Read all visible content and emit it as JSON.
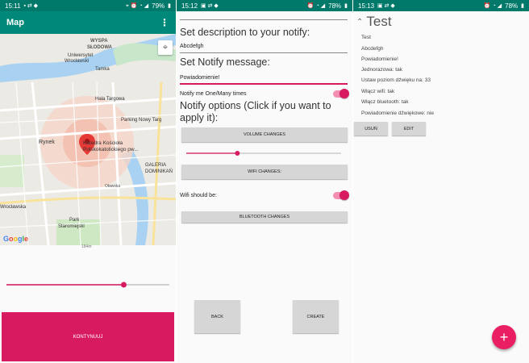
{
  "screen1": {
    "status": {
      "time": "15:11",
      "battery": "79%"
    },
    "appbar": {
      "title": "Map",
      "more_icon": "more-vert-icon"
    },
    "map": {
      "labels": {
        "wyspa": "WYSPA",
        "slodowa": "SŁODOWA",
        "uniwersytet": "Uniwersytet",
        "wroclawski": "Wrocławski",
        "tamka": "Tamka",
        "hala": "Hala Targowa",
        "parking": "Parking Nowy Targ",
        "rynek": "Rynek",
        "katedra1": "Katedra Kościoła",
        "katedra2": "Polskokatolickiego pw...",
        "galeria1": "GALERIA",
        "galeria2": "DOMINIKAŃ",
        "wroclawska": "Wrocławska",
        "park1": "Park",
        "park2": "Staromiejski",
        "olawska": "Oławska"
      },
      "google": "Google",
      "scale": "184m"
    },
    "slider": {
      "value_fraction": 0.72
    },
    "button": {
      "label": "KONTYNUUJ"
    }
  },
  "screen2": {
    "status": {
      "time": "15:12",
      "battery": "78%"
    },
    "description_label": "Set description to your notify:",
    "description_value": "Abcdefgh",
    "message_label": "Set Notify message:",
    "message_value": "Powiadomienie!",
    "notify_label": "Notify me One/Many times",
    "options_label_1": "Notify options (Click if you want to",
    "options_label_2": "apply it):",
    "volume_button": "VOLUME CHANGES",
    "volume_slider_fraction": 0.33,
    "wifi_button": "WIFI CHANGES:",
    "wifi_label": "Wifi should be:",
    "bluetooth_button": "BLUETOOTH CHANGES",
    "back_button": "BACK",
    "create_button": "CREATE"
  },
  "screen3": {
    "status": {
      "time": "15:13",
      "battery": "78%"
    },
    "title": "Test",
    "details": [
      "Test",
      "Abcdefgh",
      "Powiadomienie!",
      "Jednorazowa: tak",
      "Ustaw poziom dźwięku na: 33",
      "Włącz wifi: tak",
      "Włącz bluetooth: tak",
      "Powiadomienie dźwiękowe: nie"
    ],
    "delete_button": "USUŃ",
    "edit_button": "EDIT",
    "fab": "+"
  },
  "colors": {
    "primary": "#00897b",
    "status": "#00796b",
    "accent": "#d81b60",
    "fab": "#e91e63"
  }
}
